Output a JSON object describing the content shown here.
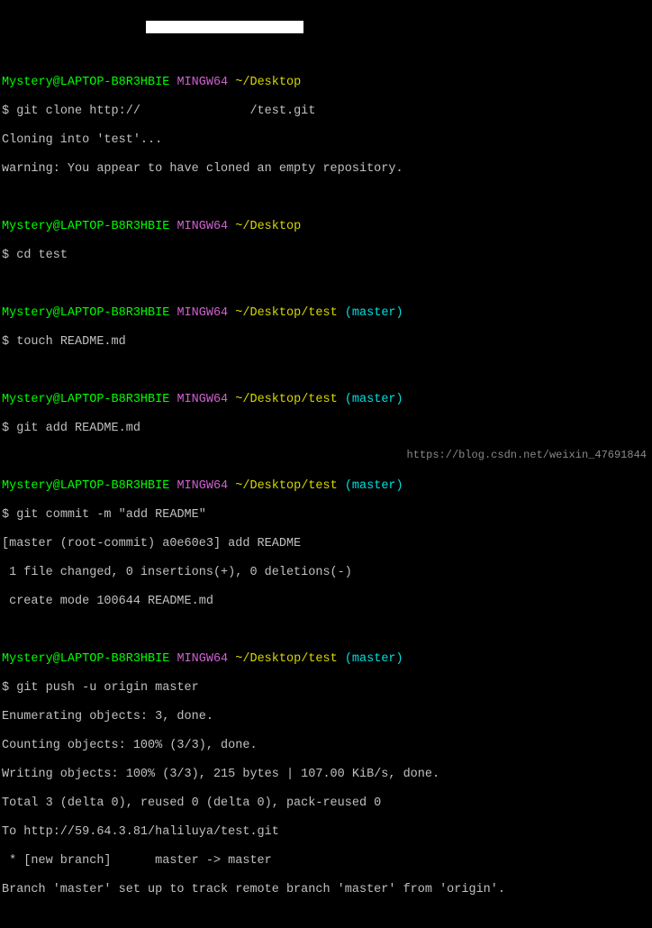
{
  "term": {
    "user": "Mystery@LAPTOP-B8R3HBIE",
    "env": "MINGW64",
    "path_desktop": "~/Desktop",
    "path_test": "~/Desktop/test",
    "branch": "(master)",
    "prompt": "$"
  },
  "block1": {
    "cmd": "git clone http://               /test.git",
    "out1": "Cloning into 'test'...",
    "out2": "warning: You appear to have cloned an empty repository."
  },
  "block2": {
    "cmd": "cd test"
  },
  "block3": {
    "cmd": "touch README.md"
  },
  "block4": {
    "cmd": "git add README.md"
  },
  "block5": {
    "cmd": "git commit -m \"add README\"",
    "out1": "[master (root-commit) a0e60e3] add README",
    "out2": " 1 file changed, 0 insertions(+), 0 deletions(-)",
    "out3": " create mode 100644 README.md"
  },
  "block6": {
    "cmd": "git push -u origin master",
    "out1": "Enumerating objects: 3, done.",
    "out2": "Counting objects: 100% (3/3), done.",
    "out3": "Writing objects: 100% (3/3), 215 bytes | 107.00 KiB/s, done.",
    "out4": "Total 3 (delta 0), reused 0 (delta 0), pack-reused 0",
    "out5": "To http://59.64.3.81/haliluya/test.git",
    "out6": " * [new branch]      master -> master",
    "out7": "Branch 'master' set up to track remote branch 'master' from 'origin'."
  },
  "watermark": "https://blog.csdn.net/weixin_47691844"
}
